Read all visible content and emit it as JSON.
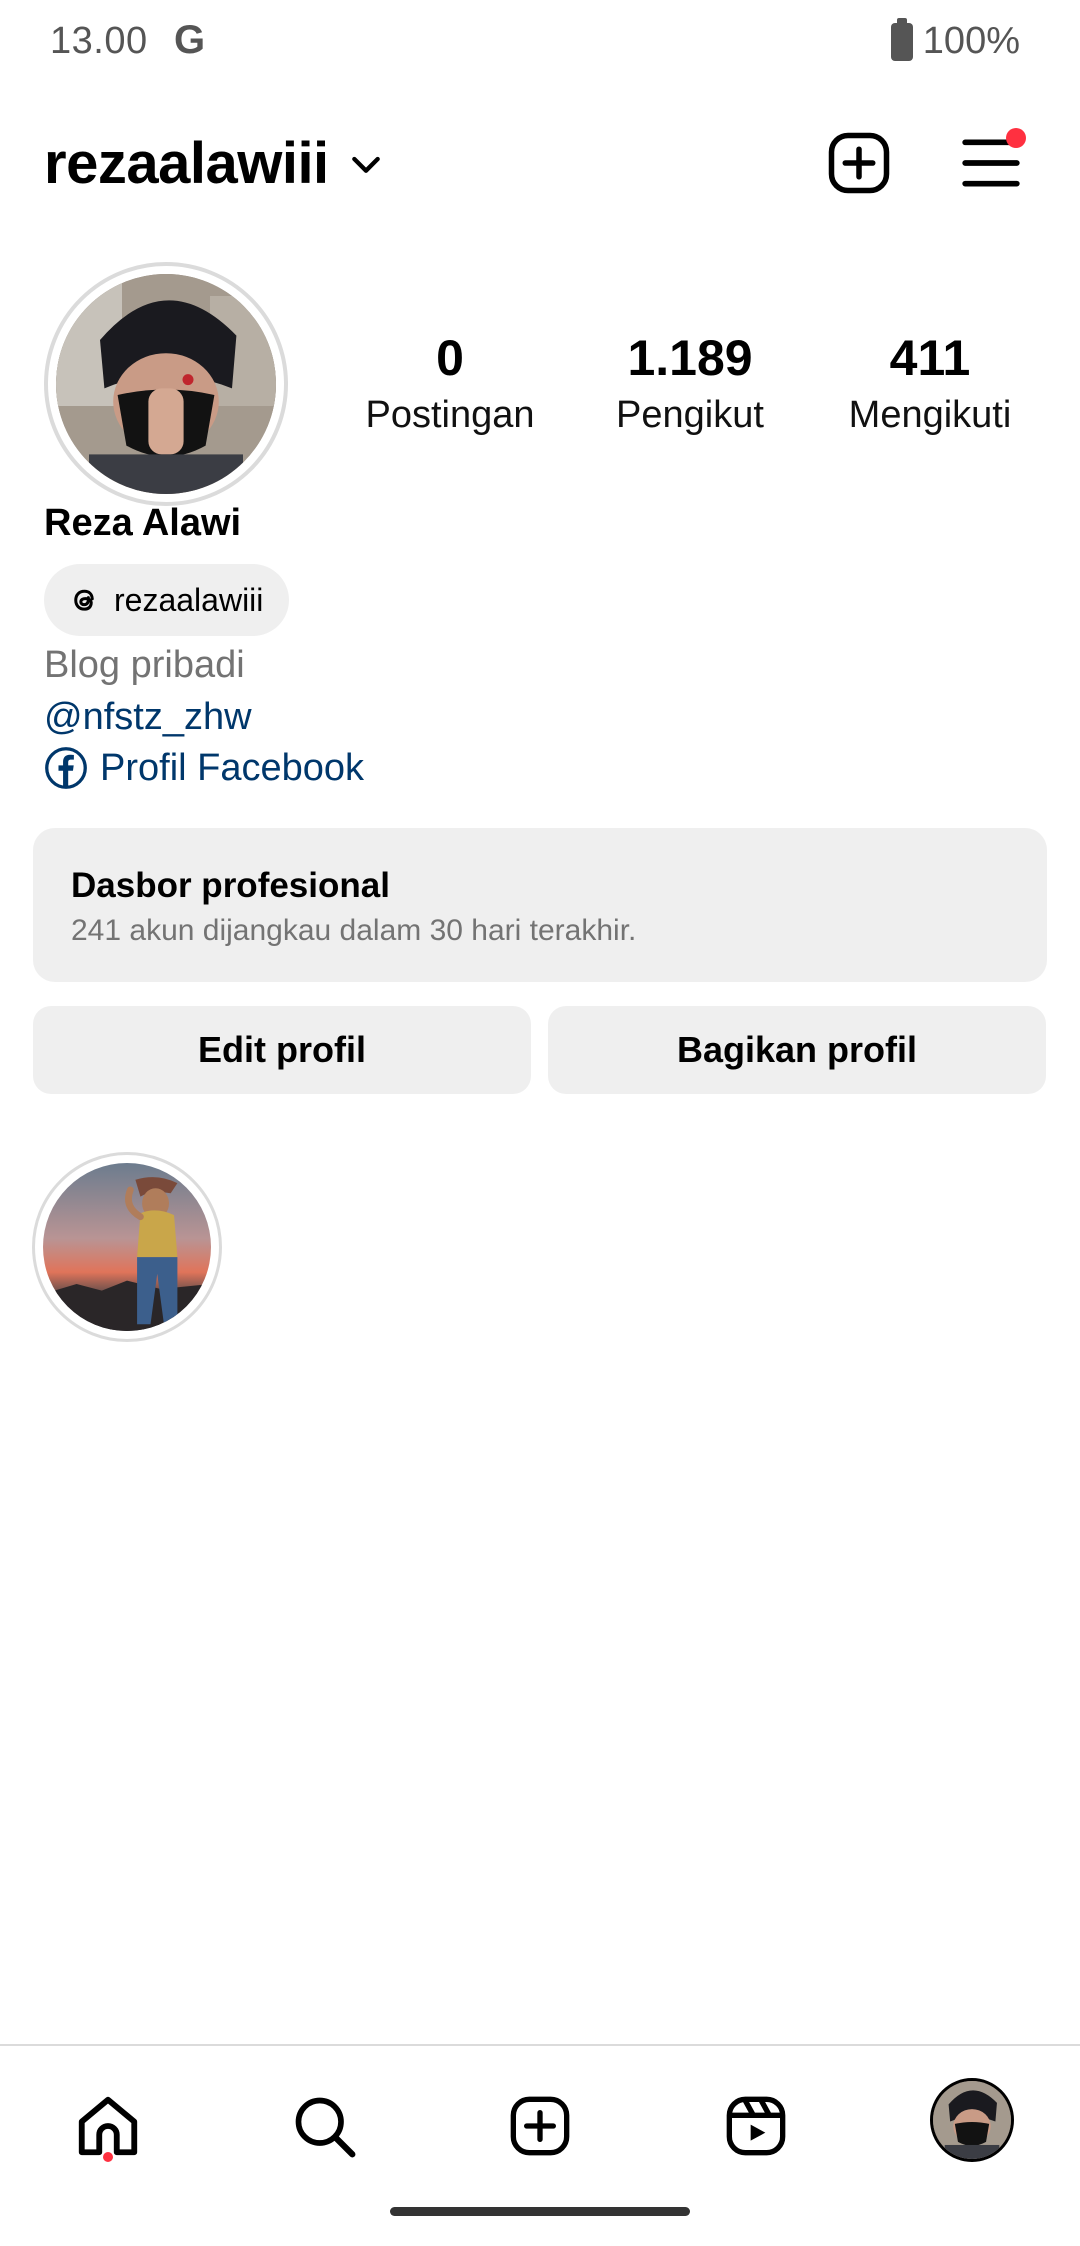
{
  "status_bar": {
    "time": "13.00",
    "carrier_icon": "G",
    "battery": "100%"
  },
  "header": {
    "username": "rezaalawiii",
    "icons": [
      "chevron-down-icon",
      "new-post-icon",
      "menu-icon"
    ],
    "has_notification": true
  },
  "profile": {
    "stats": [
      {
        "value": "0",
        "label": "Postingan"
      },
      {
        "value": "1.189",
        "label": "Pengikut"
      },
      {
        "value": "411",
        "label": "Mengikuti"
      }
    ],
    "display_name": "Reza Alawi",
    "threads_handle": "rezaalawiii",
    "category": "Blog pribadi",
    "mention": "@nfstz_zhw",
    "facebook_link": "Profil Facebook"
  },
  "dashboard": {
    "title": "Dasbor profesional",
    "subtitle": "241 akun dijangkau dalam 30 hari terakhir."
  },
  "buttons": {
    "edit": "Edit profil",
    "share": "Bagikan profil"
  },
  "bottom_nav": [
    "home-icon",
    "search-icon",
    "create-icon",
    "reels-icon",
    "profile-avatar"
  ],
  "colors": {
    "link": "#00376b",
    "secondary_text": "#737373",
    "chip_bg": "#efefef",
    "notification": "#ff3040"
  }
}
